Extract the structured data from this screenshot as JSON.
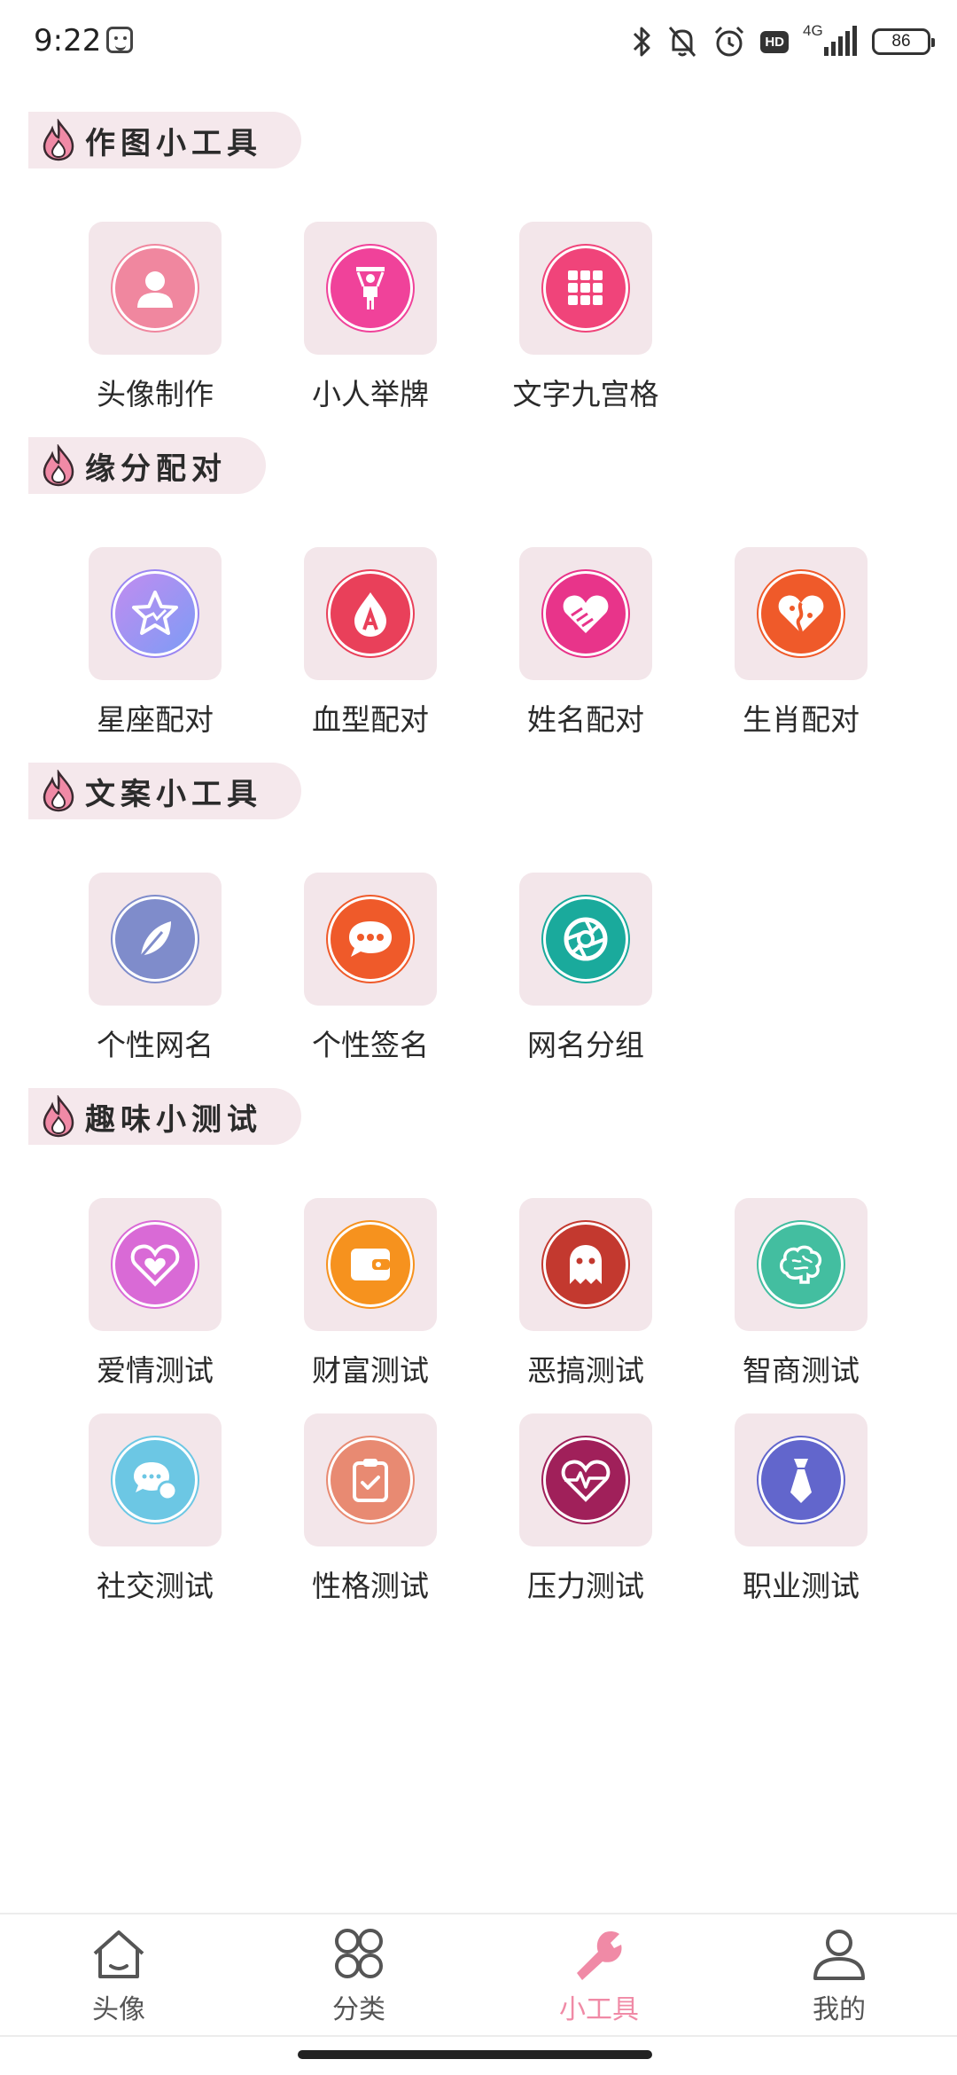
{
  "status_bar": {
    "time": "9:22",
    "network": "4G",
    "hd": "HD",
    "battery": "86",
    "icons": [
      "face-icon",
      "bluetooth-icon",
      "bell-off-icon",
      "alarm-icon",
      "hd-icon",
      "signal-icon",
      "battery-icon"
    ]
  },
  "sections": [
    {
      "title": "作图小工具",
      "items": [
        {
          "label": "头像制作",
          "icon": "person-icon",
          "color": "#f0879f"
        },
        {
          "label": "小人举牌",
          "icon": "sign-holder-icon",
          "color": "#f0429a"
        },
        {
          "label": "文字九宫格",
          "icon": "grid-icon",
          "color": "#f0447a"
        }
      ]
    },
    {
      "title": "缘分配对",
      "items": [
        {
          "label": "星座配对",
          "icon": "star-icon",
          "color": "#9a86f2"
        },
        {
          "label": "血型配对",
          "icon": "blood-drop-icon",
          "color": "#e9405a"
        },
        {
          "label": "姓名配对",
          "icon": "heart-icon",
          "color": "#e8348a"
        },
        {
          "label": "生肖配对",
          "icon": "zodiac-icon",
          "color": "#ef5a2a"
        }
      ]
    },
    {
      "title": "文案小工具",
      "items": [
        {
          "label": "个性网名",
          "icon": "feather-icon",
          "color": "#7f8ccb"
        },
        {
          "label": "个性签名",
          "icon": "chat-bubble-icon",
          "color": "#ef5a2a"
        },
        {
          "label": "网名分组",
          "icon": "aperture-icon",
          "color": "#1aaa9c"
        }
      ]
    },
    {
      "title": "趣味小测试",
      "items": [
        {
          "label": "爱情测试",
          "icon": "love-heart-icon",
          "color": "#d96ad6"
        },
        {
          "label": "财富测试",
          "icon": "wallet-icon",
          "color": "#f6921e"
        },
        {
          "label": "恶搞测试",
          "icon": "ghost-icon",
          "color": "#c3392f"
        },
        {
          "label": "智商测试",
          "icon": "brain-icon",
          "color": "#43bea0"
        },
        {
          "label": "社交测试",
          "icon": "social-icon",
          "color": "#6cc7e4"
        },
        {
          "label": "性格测试",
          "icon": "clipboard-icon",
          "color": "#e88a72"
        },
        {
          "label": "压力测试",
          "icon": "heartbeat-icon",
          "color": "#a0205a"
        },
        {
          "label": "职业测试",
          "icon": "tie-icon",
          "color": "#6266cc"
        }
      ]
    }
  ],
  "bottom_nav": [
    {
      "label": "头像",
      "icon": "home-icon",
      "active": false
    },
    {
      "label": "分类",
      "icon": "categories-icon",
      "active": false
    },
    {
      "label": "小工具",
      "icon": "wrench-icon",
      "active": true
    },
    {
      "label": "我的",
      "icon": "profile-icon",
      "active": false
    }
  ],
  "colors": {
    "accent": "#f08aa6",
    "tile_bg": "#f3e6ea",
    "header_bg": "#f5e8ec"
  }
}
